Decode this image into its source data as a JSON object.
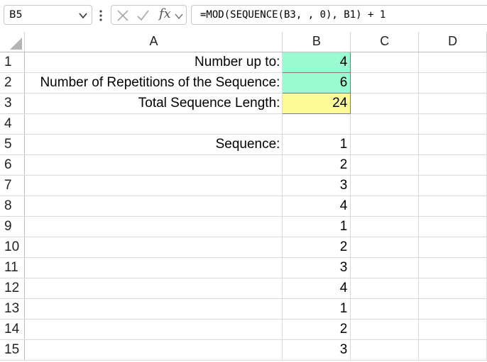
{
  "name_box": {
    "value": "B5"
  },
  "formula_bar": {
    "fx_label": "fx",
    "formula": "=MOD(SEQUENCE(B3, , 0), B1) + 1"
  },
  "columns": [
    "A",
    "B",
    "C",
    "D"
  ],
  "rows": [
    {
      "num": "1",
      "a": "Number up to:",
      "b": "4"
    },
    {
      "num": "2",
      "a": "Number of Repetitions of the Sequence:",
      "b": "6"
    },
    {
      "num": "3",
      "a": "Total Sequence Length:",
      "b": "24"
    },
    {
      "num": "4",
      "a": "",
      "b": ""
    },
    {
      "num": "5",
      "a": "Sequence:",
      "b": "1"
    },
    {
      "num": "6",
      "a": "",
      "b": "2"
    },
    {
      "num": "7",
      "a": "",
      "b": "3"
    },
    {
      "num": "8",
      "a": "",
      "b": "4"
    },
    {
      "num": "9",
      "a": "",
      "b": "1"
    },
    {
      "num": "10",
      "a": "",
      "b": "2"
    },
    {
      "num": "11",
      "a": "",
      "b": "3"
    },
    {
      "num": "12",
      "a": "",
      "b": "4"
    },
    {
      "num": "13",
      "a": "",
      "b": "1"
    },
    {
      "num": "14",
      "a": "",
      "b": "2"
    },
    {
      "num": "15",
      "a": "",
      "b": "3"
    }
  ],
  "colors": {
    "input_fill": "#99fbcf",
    "output_fill": "#fdfb98",
    "grid_line": "#dadada"
  }
}
